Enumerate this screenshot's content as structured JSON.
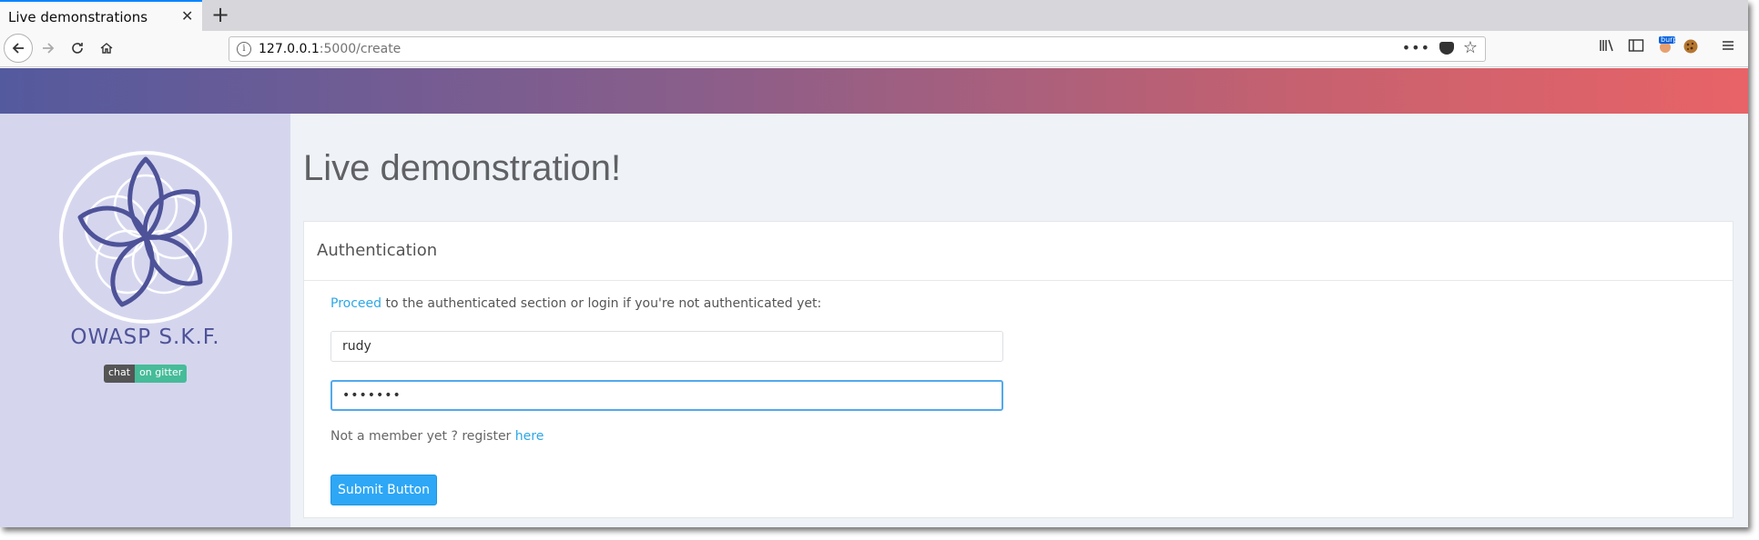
{
  "browser": {
    "tab_title": "Live demonstrations",
    "tab_close": "✕",
    "new_tab": "+",
    "url_host": "127.0.0.1",
    "url_path": ":5000/create",
    "url_more": "•••",
    "bookmark_star": "☆",
    "toolbar_badge": "burp"
  },
  "sidebar": {
    "brand": "OWASP S.K.F.",
    "gitter_left": "chat",
    "gitter_right": "on gitter"
  },
  "main": {
    "page_title": "Live demonstration!",
    "card_title": "Authentication",
    "intro_link": "Proceed",
    "intro_text": " to the authenticated section or login if you're not authenticated yet:",
    "username_value": "rudy",
    "password_value": "•••••••",
    "register_text": "Not a member yet ? register ",
    "register_link": "here",
    "submit_label": "Submit Button"
  },
  "colors": {
    "accent_link": "#2da7e6",
    "button": "#2da7f6",
    "sidebar_bg": "#d5d6ee",
    "brand": "#4e5298"
  }
}
